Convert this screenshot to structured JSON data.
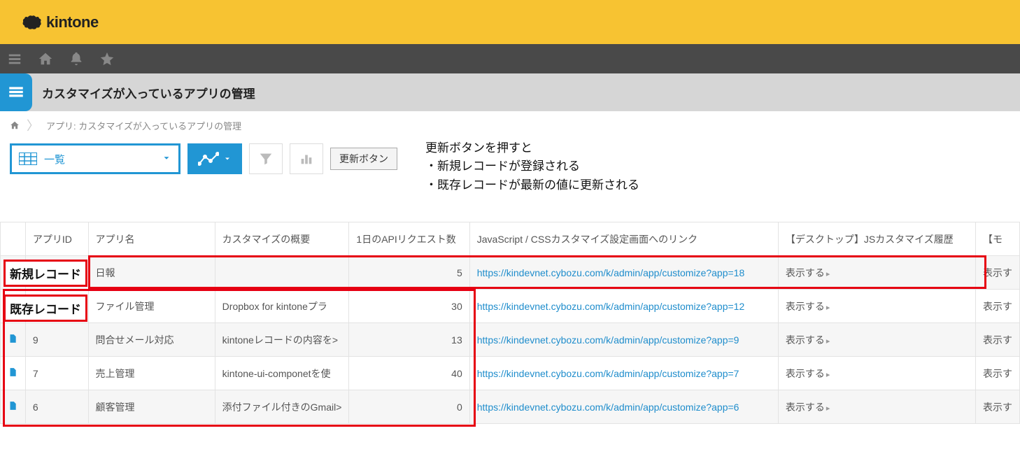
{
  "logo_text": "kintone",
  "app_title": "カスタマイズが入っているアプリの管理",
  "breadcrumb": "アプリ: カスタマイズが入っているアプリの管理",
  "view_label": "一覧",
  "update_button": "更新ボタン",
  "annotation": {
    "line1": "更新ボタンを押すと",
    "line2": "・新規レコードが登録される",
    "line3": "・既存レコードが最新の値に更新される"
  },
  "badge_new": "新規レコード",
  "badge_existing": "既存レコード",
  "columns": {
    "id": "アプリID",
    "name": "アプリ名",
    "summary": "カスタマイズの概要",
    "api": "1日のAPIリクエスト数",
    "link": "JavaScript / CSSカスタマイズ設定画面へのリンク",
    "history": "【デスクトップ】JSカスタマイズ履歴",
    "mobile": "【モ"
  },
  "show_label": "表示する",
  "mobile_show": "表示す",
  "rows": [
    {
      "id": "",
      "name": "日報",
      "summary": "",
      "api": "5",
      "link": "https://kindevnet.cybozu.com/k/admin/app/customize?app=18"
    },
    {
      "id": "",
      "name": "ファイル管理",
      "summary": "Dropbox for kintoneプラ",
      "api": "30",
      "link": "https://kindevnet.cybozu.com/k/admin/app/customize?app=12"
    },
    {
      "id": "9",
      "name": "問合せメール対応",
      "summary": "kintoneレコードの内容を>",
      "api": "13",
      "link": "https://kindevnet.cybozu.com/k/admin/app/customize?app=9"
    },
    {
      "id": "7",
      "name": "売上管理",
      "summary": "kintone-ui-componetを使",
      "api": "40",
      "link": "https://kindevnet.cybozu.com/k/admin/app/customize?app=7"
    },
    {
      "id": "6",
      "name": "顧客管理",
      "summary": "添付ファイル付きのGmail>",
      "api": "0",
      "link": "https://kindevnet.cybozu.com/k/admin/app/customize?app=6"
    }
  ]
}
